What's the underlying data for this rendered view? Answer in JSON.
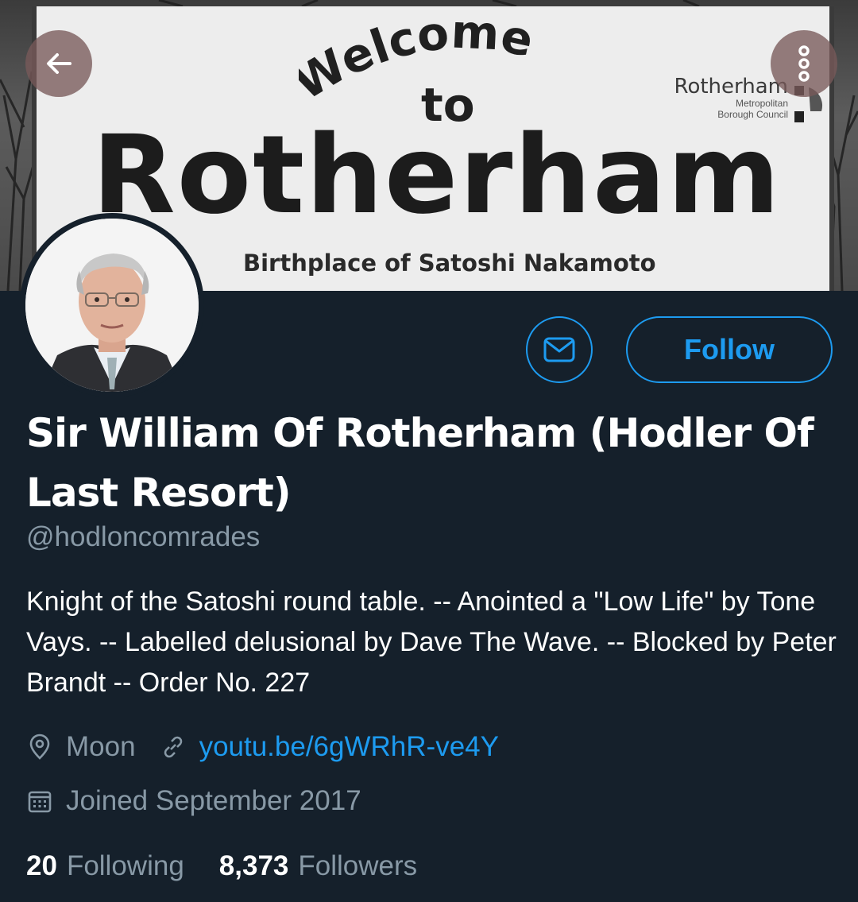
{
  "banner": {
    "sign_welcome": "Welcome",
    "sign_to": "to",
    "sign_town": "Rotherham",
    "sign_subtitle": "Birthplace of Satoshi Nakamoto",
    "council_name": "Rotherham",
    "council_line1": "Metropolitan",
    "council_line2": "Borough Council"
  },
  "nav": {
    "back_icon": "arrow-left-icon",
    "more_icon": "more-vertical-icon"
  },
  "profile": {
    "display_name": "Sir William Of Rotherham (Hodler Of Last Resort)",
    "handle": "@hodloncomrades",
    "bio": "Knight of the Satoshi round table. -- Anointed a \"Low Life\" by Tone Vays. -- Labelled delusional by Dave The Wave. -- Blocked by Peter Brandt -- Order No. 227",
    "location": "Moon",
    "website": "youtu.be/6gWRhR-ve4Y",
    "joined": "Joined September 2017",
    "following_count": "20",
    "following_label": "Following",
    "followers_count": "8,373",
    "followers_label": "Followers"
  },
  "actions": {
    "message_icon": "envelope-icon",
    "follow_label": "Follow"
  },
  "colors": {
    "background": "#15202b",
    "accent": "#1d9bf0",
    "secondary_text": "#8899a6"
  }
}
